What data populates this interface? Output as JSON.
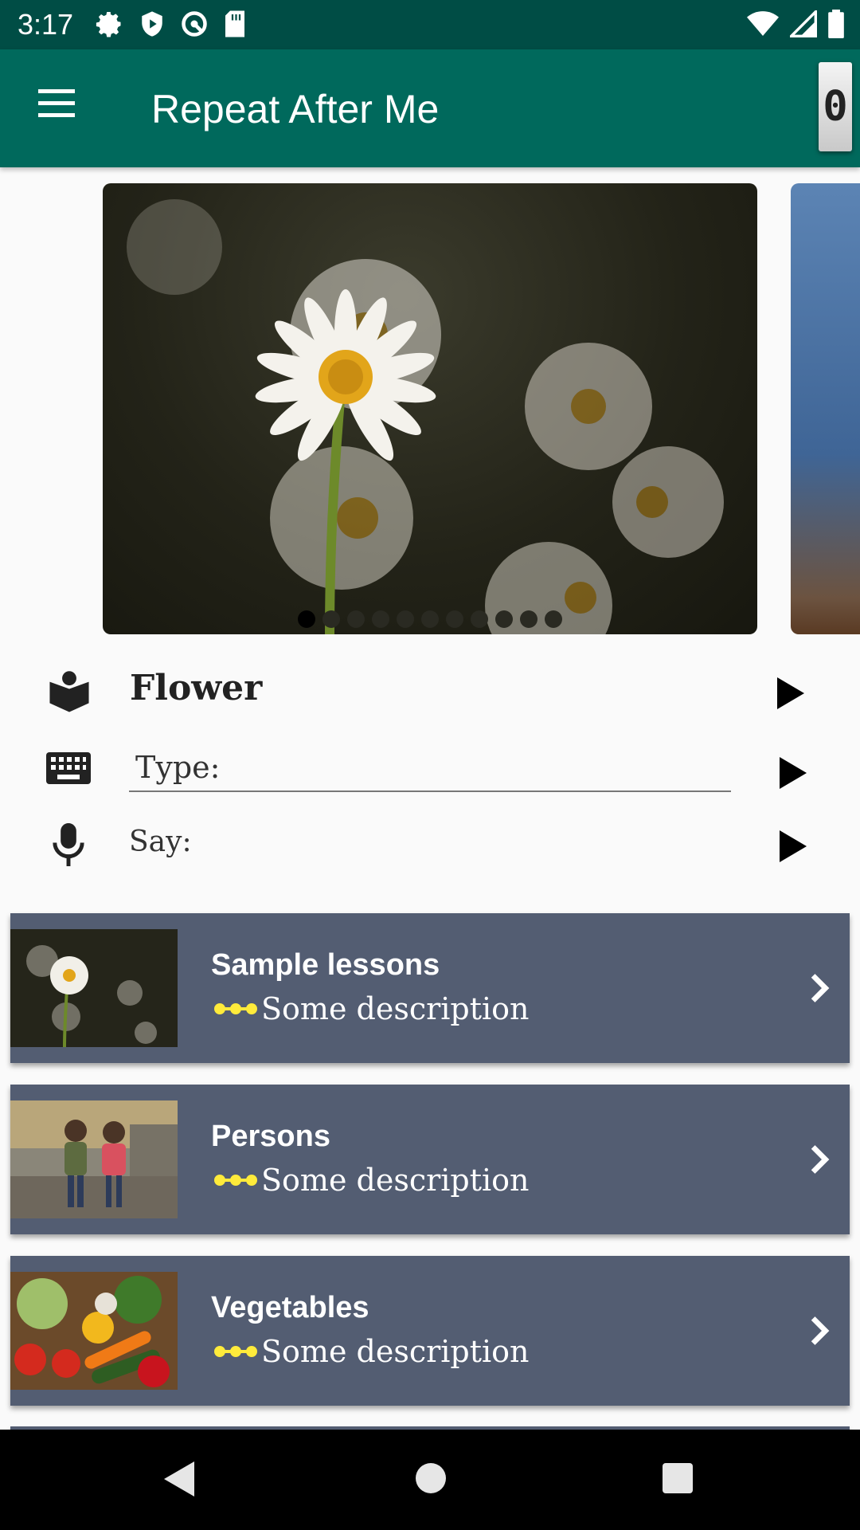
{
  "status_bar": {
    "time": "3:17",
    "left_icons": [
      "gear-icon",
      "shield-play-icon",
      "radar-icon",
      "sd-card-icon"
    ],
    "right_icons": [
      "wifi-icon",
      "signal-icon",
      "battery-icon"
    ]
  },
  "app_bar": {
    "title": "Repeat After Me",
    "score": "0"
  },
  "carousel": {
    "current_image": "daisy flowers photo",
    "next_image": "person in denim photo",
    "page_count": 11,
    "active_page": 0
  },
  "word": {
    "label": "Flower",
    "type_placeholder": "Type:",
    "say_label": "Say:"
  },
  "lessons": [
    {
      "title": "Sample lessons",
      "description": "Some description"
    },
    {
      "title": "Persons",
      "description": "Some description"
    },
    {
      "title": "Vegetables",
      "description": "Some description"
    }
  ],
  "colors": {
    "status_bar": "#004d45",
    "app_bar": "#00695c",
    "card": "#535d72",
    "desc_icon": "#ffeb3b"
  }
}
